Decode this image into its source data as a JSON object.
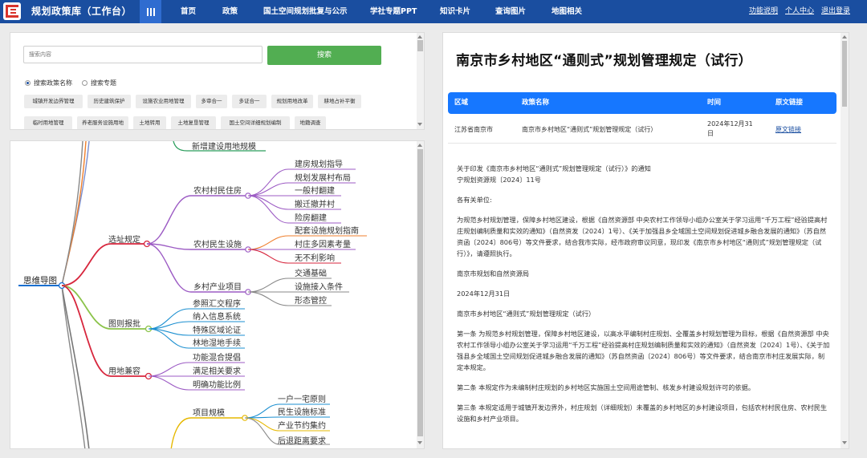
{
  "nav": {
    "title": "规划政策库（工作台）",
    "links": [
      "首页",
      "政策",
      "国土空间规划批复与公示",
      "学社专题PPT",
      "知识卡片",
      "查询图片",
      "地图相关"
    ],
    "right_links": [
      "功能说明",
      "个人中心",
      "退出登录"
    ]
  },
  "search": {
    "placeholder": "搜索内容",
    "button": "搜索",
    "radio_policy": "搜索政策名称",
    "radio_topic": "搜索专题",
    "tags_row1": [
      "城镇开发边界管理",
      "历史建筑保护",
      "设施农业用地管理",
      "多审合一",
      "多证合一",
      "规划用地改革",
      "耕地占补平衡"
    ],
    "tags_row2": [
      "临时用地管理",
      "养老服务设施用地",
      "土地转用",
      "土地复垦管理",
      "国土空间详细规划编制",
      "地籍调查"
    ]
  },
  "mindmap": {
    "root": "思维导图",
    "top_leaf": "新增建设用地规模",
    "branches": [
      {
        "label": "选址规定",
        "children": [
          {
            "label": "农村村民住房",
            "leaves": [
              "建房规划指导",
              "规划发展村布局",
              "一般村翻建",
              "搬迁撤并村",
              "险房翻建"
            ]
          },
          {
            "label": "农村民生设施",
            "leaves": [
              "配套设施规划指南",
              "村庄多因素考量",
              "无不利影响"
            ]
          },
          {
            "label": "乡村产业项目",
            "leaves": [
              "交通基础",
              "设施接入条件",
              "形态管控"
            ]
          }
        ]
      },
      {
        "label": "图则报批",
        "leaves": [
          "参照汇交程序",
          "纳入信息系统",
          "特殊区域论证",
          "林地湿地手续"
        ]
      },
      {
        "label": "用地兼容",
        "leaves": [
          "功能混合提倡",
          "满足相关要求",
          "明确功能比例"
        ]
      },
      {
        "label": "项目规模",
        "leaves": [
          "一户一宅原则",
          "民生设施标准",
          "产业节约集约",
          "后退距离要求"
        ]
      }
    ]
  },
  "document": {
    "title": "南京市乡村地区“通则式”规划管理规定（试行）",
    "table": {
      "headers": [
        "区域",
        "政策名称",
        "时间",
        "原文链接"
      ],
      "row": {
        "region": "江苏省南京市",
        "name": "南京市乡村地区“通则式”规划管理规定（试行）",
        "date_line1": "2024年12月31",
        "date_line2": "日",
        "link": "原文链接"
      }
    },
    "paragraphs": [
      "关于印发《南京市乡村地区“通则式”规划管理规定（试行）》的通知",
      "宁规划资源规〔2024〕11号",
      "各有关单位:",
      "为规范乡村规划管理，保障乡村地区建设，根据《自然资源部 中央农村工作领导小组办公室关于学习运用“千万工程”经验提高村庄规划编制质量和实效的通知》（自然资发〔2024〕1号）、《关于加强县乡全域国土空间规划促进城乡融合发展的通知》（苏自然资函〔2024〕806号）等文件要求，结合我市实际，经市政府审议同意，现印发《南京市乡村地区“通则式”规划管理规定（试行）》，请遵照执行。",
      "南京市规划和自然资源局",
      "2024年12月31日",
      "南京市乡村地区“通则式”规划管理规定（试行）",
      "第一条 为规范乡村规划管理，保障乡村地区建设，以高水平编制村庄规划、全覆盖乡村规划管理为目标，根据《自然资源部 中央农村工作领导小组办公室关于学习运用“千万工程”经验提高村庄规划编制质量和实效的通知》（自然资发〔2024〕1号）、《关于加强县乡全域国土空间规划促进城乡融合发展的通知》（苏自然资函〔2024〕806号）等文件要求，结合南京市村庄发展实际，制定本规定。",
      "第二条 本规定作为未编制村庄规划的乡村地区实施国土空间用途管制、核发乡村建设规划许可的依据。",
      "第三条 本规定适用于城镇开发边界外，村庄规划（详细规划）未覆盖的乡村地区的乡村建设项目，包括农村村民住房、农村民生设施和乡村产业项目。"
    ]
  },
  "colors": {
    "nav": "#1a4ea0",
    "accent": "#1677ff",
    "search_button": "#52ae52",
    "logo": "#d8342c"
  }
}
